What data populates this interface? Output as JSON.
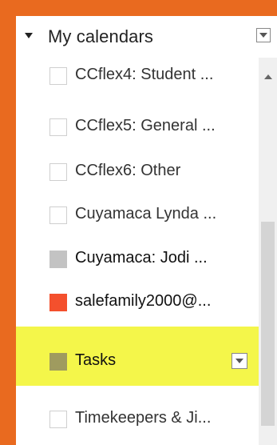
{
  "header": {
    "title": "My calendars"
  },
  "calendars": [
    {
      "label": "CCflex4: Student ...",
      "swatch_color": "#ffffff",
      "checked": false
    },
    {
      "label": "CCflex5: General ...",
      "swatch_color": "#ffffff",
      "checked": false
    },
    {
      "label": "CCflex6: Other",
      "swatch_color": "#ffffff",
      "checked": false
    },
    {
      "label": "Cuyamaca Lynda ...",
      "swatch_color": "#ffffff",
      "checked": false
    },
    {
      "label": "Cuyamaca: Jodi ...",
      "swatch_color": "#c3c3c3",
      "checked": true
    },
    {
      "label": "salefamily2000@...",
      "swatch_color": "#f4502d",
      "checked": true
    },
    {
      "label": "Tasks",
      "swatch_color": "#9f9b5f",
      "checked": true,
      "highlighted": true
    },
    {
      "label": "Timekeepers & Ji...",
      "swatch_color": "#ffffff",
      "checked": false
    }
  ],
  "colors": {
    "frame": "#e96a1f",
    "highlight": "#f4f64a",
    "scroll_track": "#f0f0f0",
    "scroll_thumb": "#d4d4d4"
  },
  "icons": {
    "collapse": "triangle-down",
    "calendar_menu": "dropdown-arrow",
    "scroll_up": "triangle-up",
    "scroll_down": "triangle-down"
  }
}
